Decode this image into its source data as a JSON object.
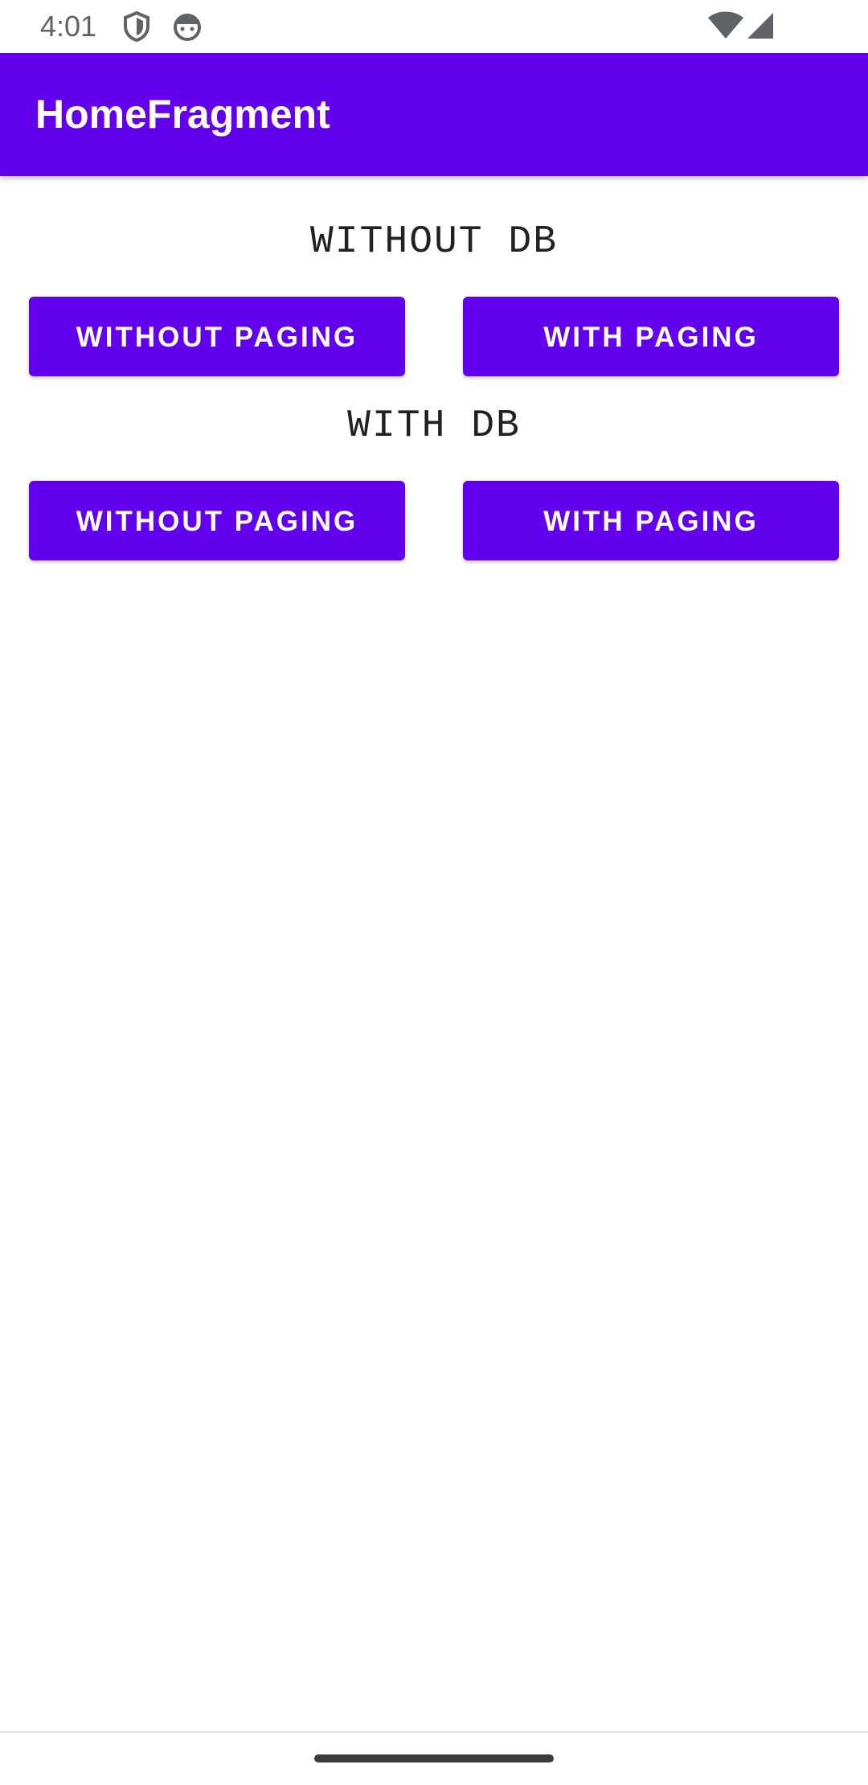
{
  "status_bar": {
    "time": "4:01",
    "left_icons": [
      "shield-icon",
      "android-face-icon"
    ],
    "right_icons": [
      "wifi-icon",
      "cellular-signal-icon"
    ]
  },
  "app_bar": {
    "title": "HomeFragment",
    "background_color": "#6200EE"
  },
  "sections": [
    {
      "label": "WITHOUT DB",
      "buttons": [
        {
          "label": "WITHOUT PAGING"
        },
        {
          "label": "WITH PAGING"
        }
      ]
    },
    {
      "label": "WITH DB",
      "buttons": [
        {
          "label": "WITHOUT PAGING"
        },
        {
          "label": "WITH PAGING"
        }
      ]
    }
  ],
  "colors": {
    "primary": "#6200EE",
    "on_primary": "#FFFFFF"
  }
}
